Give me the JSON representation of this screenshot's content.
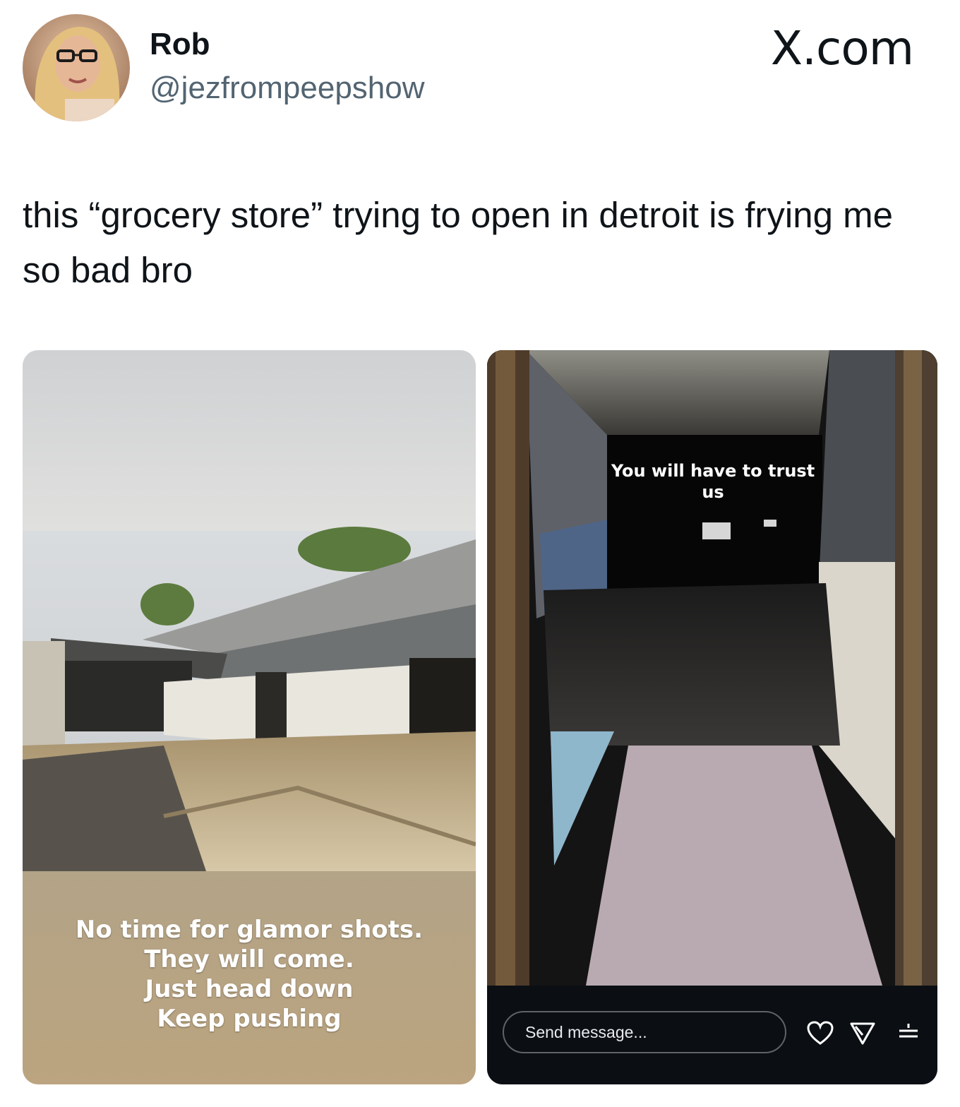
{
  "header": {
    "name": "Rob",
    "handle": "@jezfrompeepshow",
    "site": "X.com"
  },
  "tweet": {
    "text": "this “grocery store” trying to open in detroit is frying me so bad bro"
  },
  "story_left": {
    "lines": [
      "No time for glamor shots.",
      "They will come.",
      "Just head down",
      "Keep pushing"
    ]
  },
  "story_right": {
    "caption": "You will have to trust us",
    "message_placeholder": "Send message...",
    "icons": [
      "heart-icon",
      "send-icon",
      "menu-icon"
    ]
  },
  "colors": {
    "story_left_bottom": "#b9a482",
    "story_right_bar": "#0b0f14",
    "handle_gray": "#536471"
  }
}
